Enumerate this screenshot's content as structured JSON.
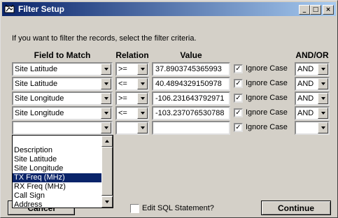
{
  "window": {
    "title": "Filter Setup",
    "icon": "app-icon",
    "controls": {
      "minimize": "_",
      "maximize": "□",
      "close": "×"
    }
  },
  "instructions": "If you want to filter the records, select the filter criteria.",
  "headers": {
    "field": "Field to Match",
    "relation": "Relation",
    "value": "Value",
    "andor": "AND/OR"
  },
  "ignore_case_label": "Ignore Case",
  "rows": [
    {
      "field": "Site Latitude",
      "relation": ">=",
      "value": "37.8903745365993",
      "ignore_case": true,
      "andor": "AND"
    },
    {
      "field": "Site Latitude",
      "relation": "<=",
      "value": "40.4894329150978",
      "ignore_case": true,
      "andor": "AND"
    },
    {
      "field": "Site Longitude",
      "relation": ">=",
      "value": "-106.231643792971",
      "ignore_case": true,
      "andor": "AND"
    },
    {
      "field": "Site Longitude",
      "relation": "<=",
      "value": "-103.237076530788",
      "ignore_case": true,
      "andor": "AND"
    },
    {
      "field": "",
      "relation": "",
      "value": "",
      "ignore_case": true,
      "andor": ""
    }
  ],
  "dropdown": {
    "options": [
      "Description",
      "Site Latitude",
      "Site Longitude",
      "TX Freq (MHz)",
      "RX Freq (MHz)",
      "Call Sign",
      "Address"
    ],
    "selected": "TX Freq (MHz)"
  },
  "footer": {
    "cancel_label": "Cancel",
    "edit_sql_label": "Edit SQL Statement?",
    "edit_sql_checked": false,
    "continue_label": "Continue"
  },
  "colors": {
    "titlebar_start": "#0a246a",
    "titlebar_end": "#a6caf0",
    "selection": "#0a246a",
    "face": "#d4d0c8"
  }
}
